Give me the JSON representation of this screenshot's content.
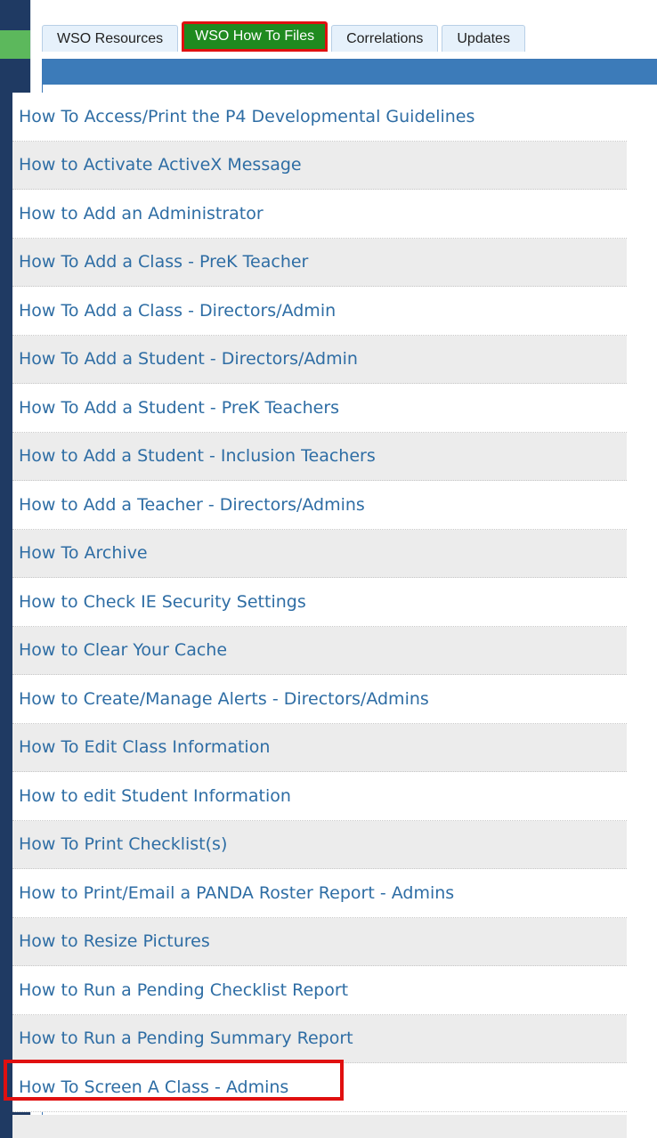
{
  "tabs": [
    {
      "label": "WSO Resources"
    },
    {
      "label": "WSO How To Files"
    },
    {
      "label": "Correlations"
    },
    {
      "label": "Updates"
    }
  ],
  "how_to_files": [
    "How To Access/Print the P4 Developmental Guidelines",
    "How to Activate ActiveX Message",
    "How to Add an Administrator",
    "How To Add a Class - PreK Teacher",
    "How To Add a Class - Directors/Admin",
    "How To Add a Student - Directors/Admin",
    "How To Add a Student - PreK Teachers",
    "How to Add a Student - Inclusion Teachers",
    "How to Add a Teacher - Directors/Admins",
    "How To Archive",
    "How to Check IE Security Settings",
    "How to Clear Your Cache",
    "How to Create/Manage Alerts - Directors/Admins",
    "How To Edit Class Information",
    "How to edit Student Information",
    "How To Print Checklist(s)",
    "How to Print/Email a PANDA Roster Report - Admins",
    "How to Resize Pictures",
    "How to Run a Pending Checklist Report",
    "How to Run a Pending Summary Report",
    "How To Screen A Class - Admins"
  ],
  "colors": {
    "active_tab": "#1f8a1f",
    "highlight": "#e01010",
    "header_bar": "#3c7bb9",
    "link": "#2e6da4"
  }
}
